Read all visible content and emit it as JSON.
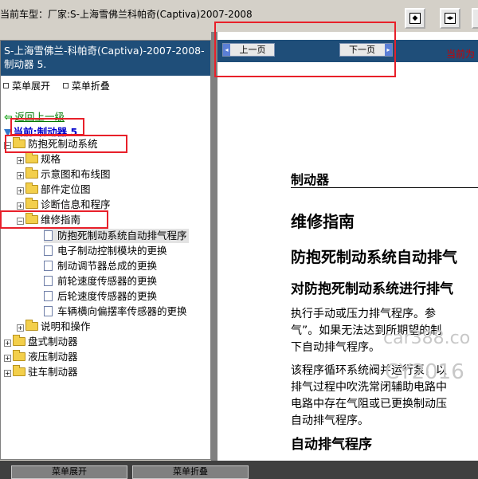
{
  "header": {
    "breadcrumb": "当前车型：厂家:S-上海雪佛兰科帕奇(Captiva)2007-2008"
  },
  "toolbar": {
    "buttons": [
      {
        "icon": "frame-left-icon",
        "glyph": "◂▸"
      },
      {
        "icon": "frame-split-icon",
        "glyph": "◂▸"
      },
      {
        "icon": "frame-right-icon",
        "glyph": "◂"
      }
    ]
  },
  "sidebar": {
    "vehicle_title": "S-上海雪佛兰-科帕奇(Captiva)-2007-2008- 制动器 5.",
    "expand_label": "菜单展开",
    "collapse_label": "菜单折叠",
    "back_label": "返回上一级",
    "current_label": "当前:制动器 5",
    "tree": {
      "abs": "防抱死制动系统",
      "spec": "规格",
      "diagram": "示意图和布线图",
      "location": "部件定位图",
      "diagnosis": "诊断信息和程序",
      "repair": "维修指南",
      "item1": "防抱死制动系统自动排气程序",
      "item2": "电子制动控制模块的更换",
      "item3": "制动调节器总成的更换",
      "item4": "前轮速度传感器的更换",
      "item5": "后轮速度传感器的更换",
      "item6": "车辆横向偏摆率传感器的更换",
      "desc": "说明和操作",
      "disc": "盘式制动器",
      "hydraulic": "液压制动器",
      "parking": "驻车制动器"
    }
  },
  "content_nav": {
    "prev_label": "上一页",
    "next_label": "下一页",
    "current_prefix": "当前为"
  },
  "document": {
    "section": "制动器",
    "heading": "维修指南",
    "title": "防抱死制动系统自动排气",
    "subtitle": "对防抱死制动系统进行排气",
    "para1_line1": "执行手动或压力排气程序。参",
    "para1_line2": "气”。如果无法达到所期望的制",
    "para1_line3": "下自动排气程序。",
    "para2_line1": "该程序循环系统阀并运行泵，以",
    "para2_line2": "排气过程中吹洗常闭辅助电路中",
    "para2_line3": "电路中存在气阻或已更换制动压",
    "para2_line4": "自动排气程序。",
    "h_auto": "自动排气程序",
    "watermark1": "car388.co",
    "watermark2": "CY2016"
  },
  "bottom": {
    "expand_label": "菜单展开",
    "collapse_label": "菜单折叠"
  },
  "colors": {
    "accent": "#1f4e79",
    "highlight": "#e8202a"
  }
}
